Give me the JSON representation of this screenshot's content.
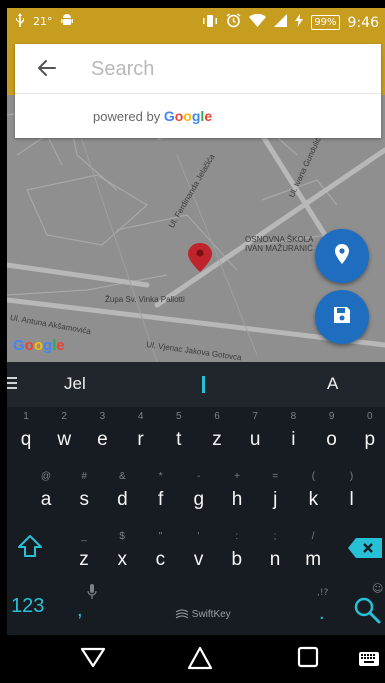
{
  "status_bar": {
    "temperature": "21°",
    "battery": "99%",
    "time": "9:46"
  },
  "search": {
    "placeholder": "Search",
    "value": "",
    "powered_by_prefix": "powered by",
    "powered_by_brand": "Google"
  },
  "map": {
    "labels": {
      "street_1": "Ul. Vjenac Jakova Gotovca",
      "street_2": "Ul. Vjenac Jakova Gotovca",
      "street_3": "Ul. Antuna Akšamovića",
      "street_4": "Ul. Ferdinanda Jelačića",
      "street_5": "Ul. Ivana Gundulića",
      "school": "OSNOVNA ŠKOLA IVAN MAŽURANIĆ",
      "parish": "Župa Sv. Vinka Pallotti"
    },
    "google_logo": "Google"
  },
  "keyboard": {
    "suggestions": [
      "Jel",
      "I",
      "A"
    ],
    "rows": [
      [
        {
          "hint": "1",
          "ch": "q"
        },
        {
          "hint": "2",
          "ch": "w"
        },
        {
          "hint": "3",
          "ch": "e"
        },
        {
          "hint": "4",
          "ch": "r"
        },
        {
          "hint": "5",
          "ch": "t"
        },
        {
          "hint": "6",
          "ch": "z"
        },
        {
          "hint": "7",
          "ch": "u"
        },
        {
          "hint": "8",
          "ch": "i"
        },
        {
          "hint": "9",
          "ch": "o"
        },
        {
          "hint": "0",
          "ch": "p"
        }
      ],
      [
        {
          "hint": "@",
          "ch": "a"
        },
        {
          "hint": "#",
          "ch": "s"
        },
        {
          "hint": "&",
          "ch": "d"
        },
        {
          "hint": "*",
          "ch": "f"
        },
        {
          "hint": "-",
          "ch": "g"
        },
        {
          "hint": "+",
          "ch": "h"
        },
        {
          "hint": "=",
          "ch": "j"
        },
        {
          "hint": "(",
          "ch": "k"
        },
        {
          "hint": ")",
          "ch": "l"
        }
      ],
      [
        {
          "hint": "_",
          "ch": "z"
        },
        {
          "hint": "$",
          "ch": "x"
        },
        {
          "hint": "\"",
          "ch": "c"
        },
        {
          "hint": "'",
          "ch": "v"
        },
        {
          "hint": ":",
          "ch": "b"
        },
        {
          "hint": ";",
          "ch": "n"
        },
        {
          "hint": "/",
          "ch": "m"
        }
      ]
    ],
    "numbers_key": "123",
    "comma_key": ",",
    "period_key": ".",
    "punct_hint": ",!?",
    "space_label": "SwiftKey"
  },
  "colors": {
    "accent": "#c79d1f",
    "fab": "#1e6dbe",
    "keyboard_accent": "#27c1d6",
    "pin": "#c0232b"
  }
}
